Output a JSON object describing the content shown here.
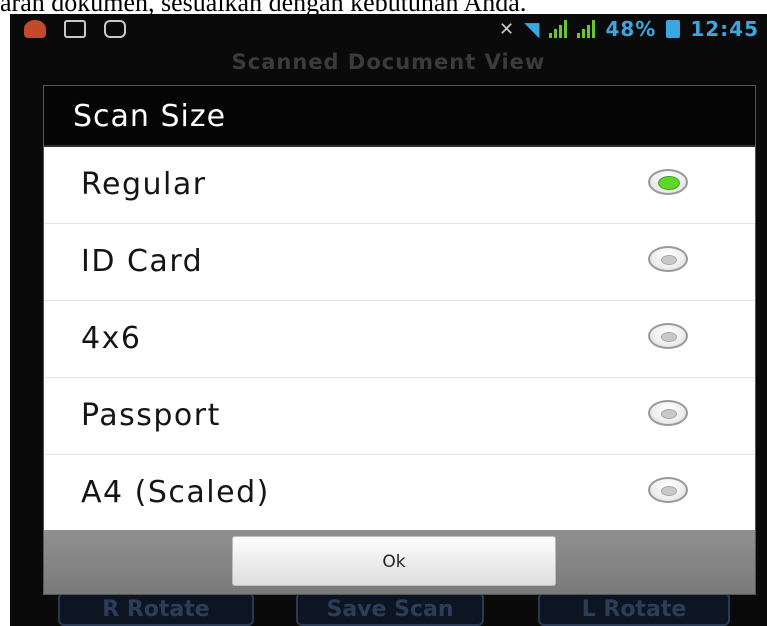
{
  "page_caption": "aran dokumen, sesuaikan dengan kebutuhan Anda.",
  "status_bar": {
    "battery": "48%",
    "time": "12:45",
    "icons": [
      "notification-icon",
      "image-icon",
      "chat-icon",
      "mute-icon",
      "wifi-icon",
      "signal-icon",
      "signal-icon",
      "battery-icon"
    ]
  },
  "background_screen": {
    "title": "Scanned Document View",
    "buttons": [
      "R Rotate",
      "Save Scan",
      "L Rotate"
    ]
  },
  "dialog": {
    "title": "Scan Size",
    "options": [
      {
        "label": "Regular",
        "selected": true
      },
      {
        "label": "ID Card",
        "selected": false
      },
      {
        "label": "4x6",
        "selected": false
      },
      {
        "label": "Passport",
        "selected": false
      },
      {
        "label": "A4 (Scaled)",
        "selected": false
      }
    ],
    "ok_label": "Ok"
  },
  "colors": {
    "status_text": "#3aa8e0",
    "radio_selected": "#5ed62b",
    "dialog_header": "#050505"
  }
}
